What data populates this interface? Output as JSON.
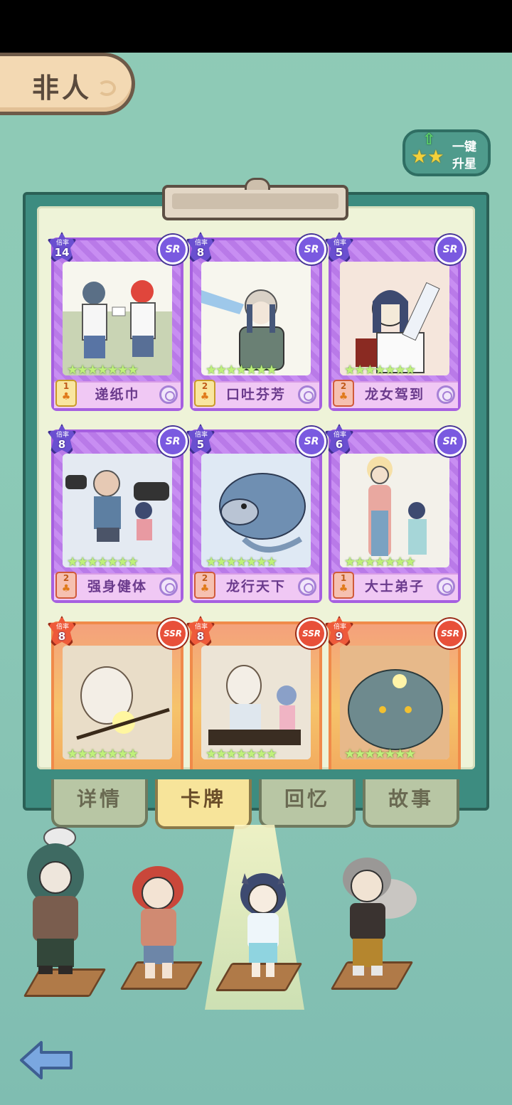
{
  "page": {
    "title": "非人",
    "upgrade_button": {
      "line1": "一键",
      "line2": "升星",
      "icon": "stars-upgrade-icon"
    }
  },
  "badge_small_label": "倍率",
  "cards": [
    {
      "name": "递纸巾",
      "multiplier": "14",
      "rarity": "SR",
      "level": "1",
      "stars": "★★★★★★★"
    },
    {
      "name": "口吐芬芳",
      "multiplier": "8",
      "rarity": "SR",
      "level": "2",
      "stars": "★★★★★★★"
    },
    {
      "name": "龙女驾到",
      "multiplier": "5",
      "rarity": "SR",
      "level": "2",
      "stars": "★★★★★★★"
    },
    {
      "name": "强身健体",
      "multiplier": "8",
      "rarity": "SR",
      "level": "2",
      "stars": "★★★★★★★"
    },
    {
      "name": "龙行天下",
      "multiplier": "5",
      "rarity": "SR",
      "level": "2",
      "stars": "★★★★★★★"
    },
    {
      "name": "大士弟子",
      "multiplier": "6",
      "rarity": "SR",
      "level": "1",
      "stars": "★★★★★★★"
    },
    {
      "name": "",
      "multiplier": "8",
      "rarity": "SSR",
      "level": "",
      "stars": "★★★★★★★"
    },
    {
      "name": "",
      "multiplier": "8",
      "rarity": "SSR",
      "level": "",
      "stars": "★★★★★★★"
    },
    {
      "name": "",
      "multiplier": "9",
      "rarity": "SSR",
      "level": "",
      "stars": "★★★★★★★"
    }
  ],
  "tabs": [
    {
      "label": "详情",
      "active": false
    },
    {
      "label": "卡牌",
      "active": true
    },
    {
      "label": "回忆",
      "active": false
    },
    {
      "label": "故事",
      "active": false
    }
  ],
  "characters": [
    {
      "name": "character-green-hair"
    },
    {
      "name": "character-red-hair"
    },
    {
      "name": "character-dragon-girl",
      "selected": true
    },
    {
      "name": "character-grey-hair"
    }
  ],
  "colors": {
    "sr_frame": "#a65fe0",
    "ssr_frame": "#f08a4a",
    "active_tab": "#f7e49a"
  }
}
